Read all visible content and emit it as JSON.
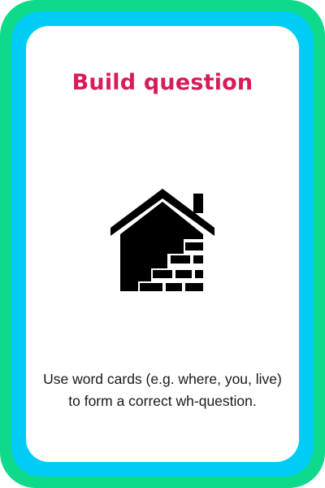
{
  "card": {
    "title": "Build question",
    "description": "Use word cards (e.g. where, you, live) to form a correct wh-question.",
    "icon": "house-brick-icon"
  },
  "colors": {
    "outer_border": "#0fd98a",
    "inner_border": "#00ccf5",
    "background": "#ffffff",
    "title": "#d81b5a",
    "icon": "#000000",
    "text": "#1a1a1a"
  }
}
